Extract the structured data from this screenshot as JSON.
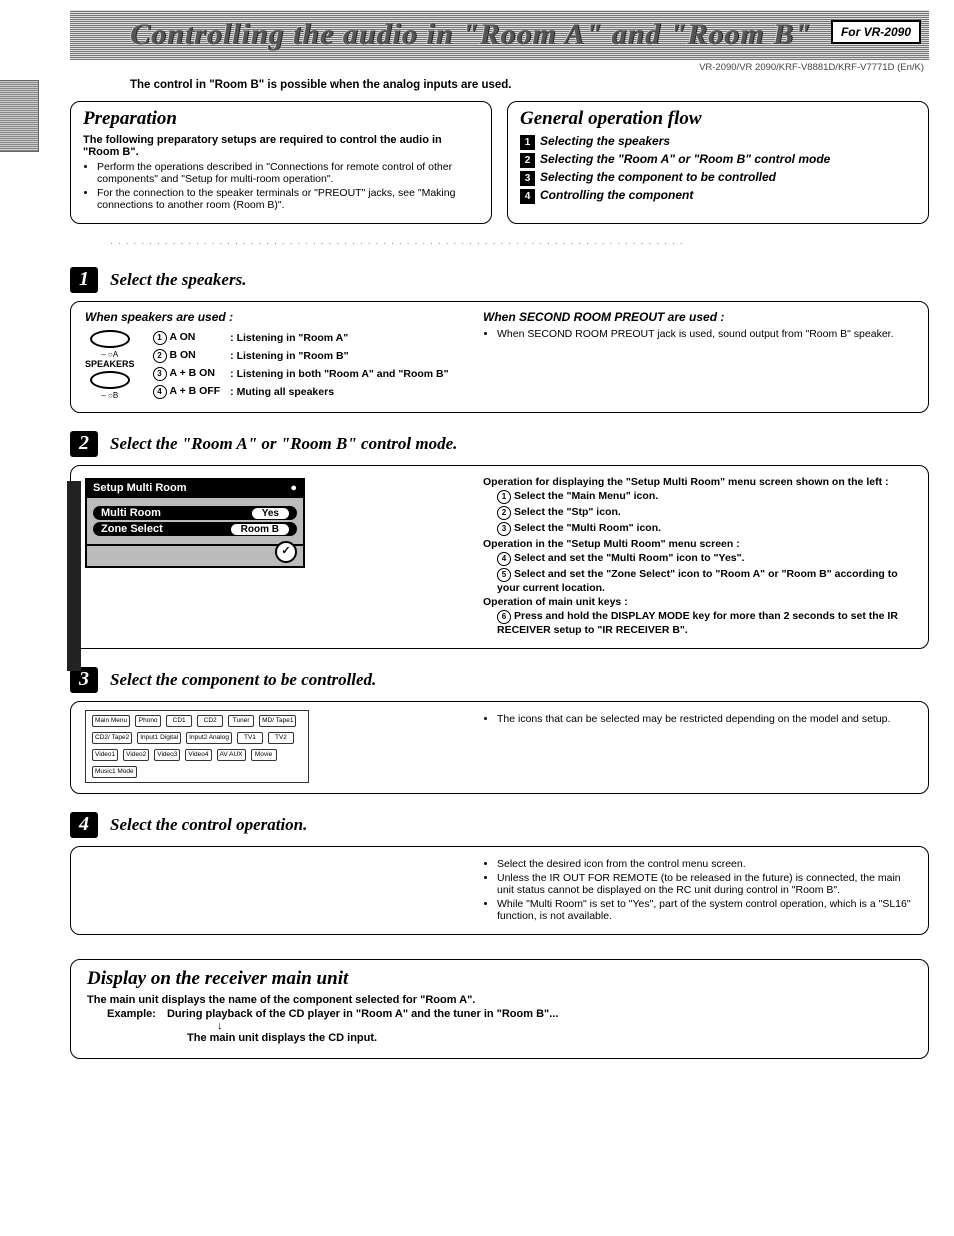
{
  "header": {
    "title": "Controlling the audio in \"Room A\" and \"Room B\"",
    "for_model": "For VR-2090",
    "models_line": "VR-2090/VR 2090/KRF-V8881D/KRF-V7771D (En/K)"
  },
  "intro": "The control in \"Room B\" is possible when the analog inputs are used.",
  "preparation": {
    "title": "Preparation",
    "lead": "The following preparatory setups are required to control the audio in \"Room B\".",
    "b1": "Perform the operations described in \"Connections for remote control of other components\" and \"Setup for multi-room operation\".",
    "b2": "For the connection to the speaker terminals or \"PREOUT\" jacks, see \"Making connections to another room (Room B)\"."
  },
  "flow": {
    "title": "General operation flow",
    "items": [
      "Selecting the speakers",
      "Selecting the \"Room A\" or \"Room B\" control mode",
      "Selecting the component to be controlled",
      "Controlling the component"
    ]
  },
  "step1": {
    "title": "Select the speakers.",
    "left_sub": "When speakers are used :",
    "spk_label": "SPEAKERS",
    "row_a_on_l": "A ON",
    "row_a_on_r": ": Listening in \"Room A\"",
    "row_b_on_l": "B ON",
    "row_b_on_r": ": Listening in \"Room B\"",
    "row_ab_on_l": "A + B ON",
    "row_ab_on_r": ": Listening in both \"Room A\" and \"Room B\"",
    "row_ab_off_l": "A + B OFF",
    "row_ab_off_r": ": Muting all speakers",
    "right_sub": "When SECOND ROOM PREOUT are used :",
    "right_text": "When SECOND ROOM PREOUT jack is used, sound output from \"Room B\" speaker."
  },
  "step2": {
    "title": "Select the \"Room A\" or \"Room B\" control mode.",
    "osd_header": "Setup Multi Room",
    "osd_row1_l": "Multi Room",
    "osd_row1_r": "Yes",
    "osd_row2_l": "Zone Select",
    "osd_row2_r": "Room B",
    "op_disp": "Operation for displaying the \"Setup Multi Room\" menu screen shown on the left :",
    "op1": "Select the \"Main Menu\" icon.",
    "op2": "Select the \"Stp\" icon.",
    "op3": "Select the \"Multi Room\" icon.",
    "op_in": "Operation in the \"Setup Multi Room\" menu screen :",
    "op4": "Select and set the \"Multi Room\" icon to \"Yes\".",
    "op5": "Select and set the \"Zone Select\" icon to \"Room A\" or \"Room B\" according to your current location.",
    "op_main": "Operation of main unit keys :",
    "op6": "Press and hold the DISPLAY MODE key for more than 2 seconds to set the IR RECEIVER setup to \"IR RECEIVER B\"."
  },
  "step3": {
    "title": "Select the component to be controlled.",
    "right_text": "The icons that can be selected may be restricted depending on the model and setup.",
    "remote_labels": [
      "Main Menu",
      "Phono",
      "CD1",
      "CD2",
      "Tuner",
      "MD/ Tape1",
      "CD2/ Tape2",
      "Input1 Digital",
      "Input2 Analog",
      "TV1",
      "TV2",
      "Video1",
      "Video2",
      "Video3",
      "Video4",
      "AV AUX",
      "Movie",
      "Music1 Mode"
    ]
  },
  "step4": {
    "title": "Select the control operation.",
    "b1": "Select the desired icon from the control menu screen.",
    "b2": "Unless the IR OUT FOR REMOTE (to be released in the future) is connected, the main unit status cannot be displayed on the RC unit during control in \"Room B\".",
    "b3": "While \"Multi Room\" is set to \"Yes\", part of the system control operation, which is a \"SL16\" function, is not available."
  },
  "display": {
    "title": "Display on the receiver main unit",
    "line1": "The main unit displays the name of the component selected for \"Room A\".",
    "example_l": "Example:",
    "example_r": "During playback of the CD player in \"Room A\" and the tuner in \"Room B\"...",
    "arrow": "↓",
    "line2": "The main unit displays the CD input."
  }
}
